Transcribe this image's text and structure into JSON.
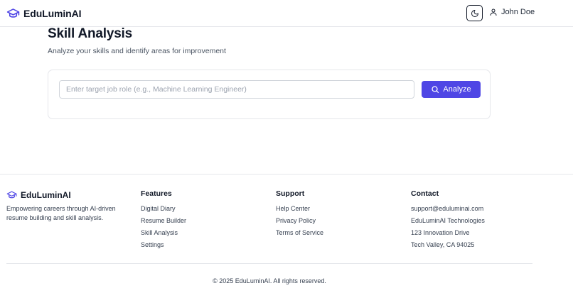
{
  "header": {
    "brand": "EduLuminAI",
    "user_name": "John Doe"
  },
  "main": {
    "title": "Skill Analysis",
    "subtitle": "Analyze your skills and identify areas for improvement",
    "input": {
      "placeholder": "Enter target job role (e.g., Machine Learning Engineer)",
      "value": ""
    },
    "analyze_label": "Analyze"
  },
  "footer": {
    "brand": "EduLuminAI",
    "tagline": "Empowering careers through AI-driven resume building and skill analysis.",
    "features": {
      "heading": "Features",
      "items": [
        "Digital Diary",
        "Resume Builder",
        "Skill Analysis",
        "Settings"
      ]
    },
    "support": {
      "heading": "Support",
      "items": [
        "Help Center",
        "Privacy Policy",
        "Terms of Service"
      ]
    },
    "contact": {
      "heading": "Contact",
      "items": [
        "support@eduluminai.com",
        "EduLuminAI Technologies",
        "123 Innovation Drive",
        "Tech Valley, CA 94025"
      ]
    },
    "copyright": "© 2025 EduLuminAI. All rights reserved."
  },
  "colors": {
    "accent": "#4f46e5",
    "text": "#111827",
    "muted": "#4b5563",
    "border": "#e5e7eb"
  },
  "icons": {
    "brand": "graduation-cap-icon",
    "theme": "moon-icon",
    "user": "user-icon",
    "analyze": "search-icon"
  }
}
